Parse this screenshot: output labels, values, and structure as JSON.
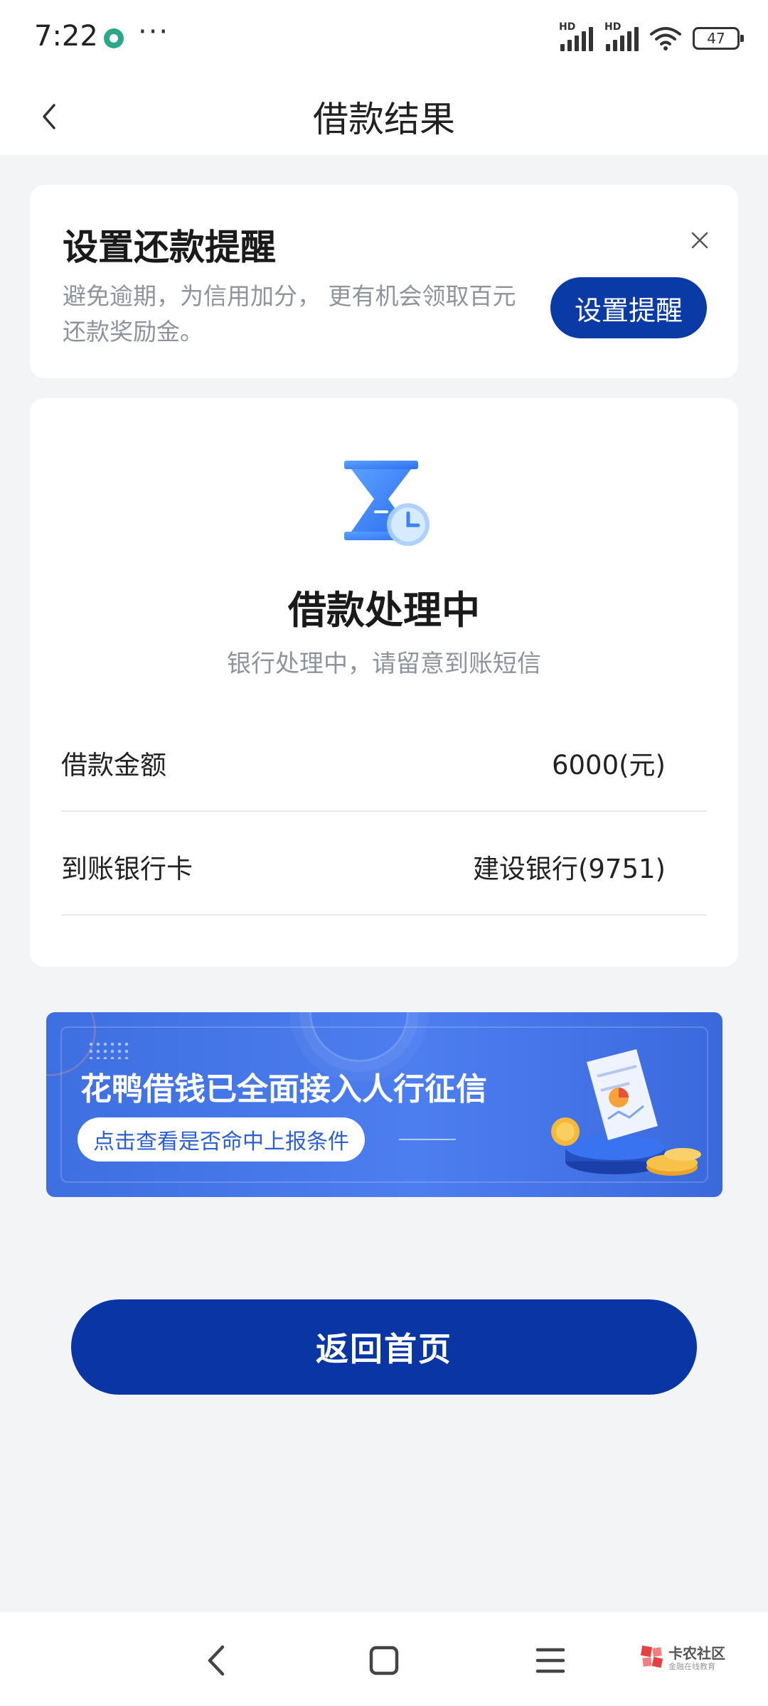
{
  "status_bar": {
    "time": "7:22",
    "more": "···",
    "signal_label_1": "HD",
    "signal_label_2": "HD",
    "battery": "47"
  },
  "header": {
    "title": "借款结果",
    "back_icon": "chevron-left-icon"
  },
  "reminder": {
    "title": "设置还款提醒",
    "description": "避免逾期，为信用加分， 更有机会领取百元还款奖励金。",
    "button_label": "设置提醒",
    "close_icon": "close-icon"
  },
  "status": {
    "icon": "hourglass-clock-icon",
    "title": "借款处理中",
    "subtitle": "银行处理中，请留意到账短信",
    "rows": [
      {
        "label": "借款金额",
        "value": "6000(元)"
      },
      {
        "label": "到账银行卡",
        "value": "建设银行(9751)"
      }
    ]
  },
  "banner": {
    "headline": "花鸭借钱已全面接入人行征信",
    "pill": "点击查看是否命中上报条件"
  },
  "home_button": {
    "label": "返回首页"
  },
  "watermark": {
    "name": "卡农社区",
    "sub": "金融在线教育"
  },
  "colors": {
    "primary": "#0a36a5",
    "background": "#f3f4f6",
    "secondary_text": "#8f949c",
    "banner": "#4d7ef0"
  }
}
